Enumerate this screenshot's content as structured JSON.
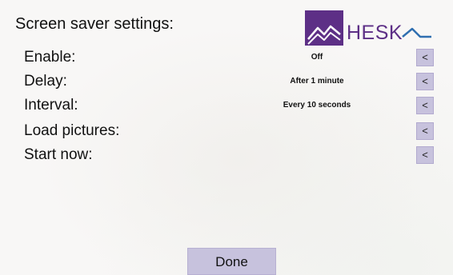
{
  "title": "Screen saver settings:",
  "logo": {
    "text": "HESK",
    "brand_color": "#5d2f86",
    "icon": "mountain-logo-icon"
  },
  "settings": [
    {
      "label": "Enable:",
      "value": "Off",
      "button": "<"
    },
    {
      "label": "Delay:",
      "value": "After 1 minute",
      "button": "<"
    },
    {
      "label": "Interval:",
      "value": "Every 10 seconds",
      "button": "<"
    },
    {
      "label": "Load pictures:",
      "value": "",
      "button": "<"
    },
    {
      "label": "Start now:",
      "value": "",
      "button": "<"
    }
  ],
  "done_label": "Done",
  "colors": {
    "button_bg": "#c7c2dd",
    "background": "#f8f7f6"
  }
}
